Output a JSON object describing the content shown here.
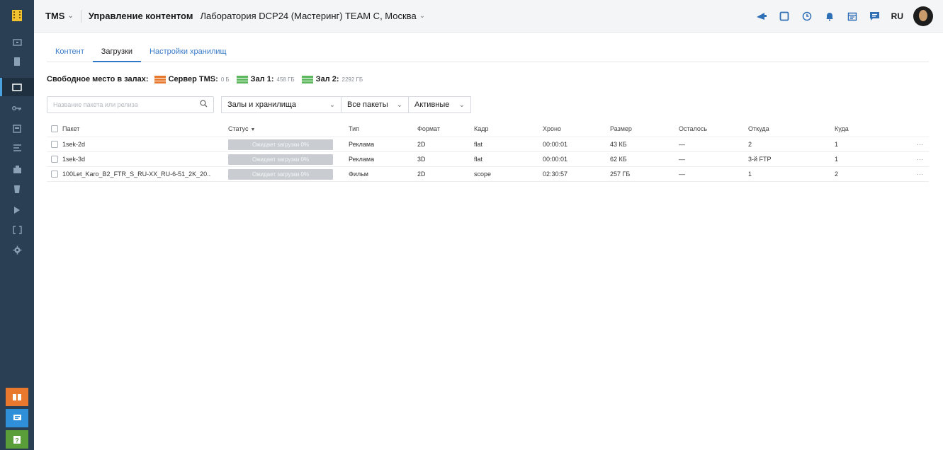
{
  "header": {
    "app_name": "TMS",
    "section": "Управление контентом",
    "location": "Лаборатория DCP24 (Мастеринг) TEAM C, Москва",
    "language": "RU"
  },
  "tabs": [
    {
      "label": "Контент"
    },
    {
      "label": "Загрузки"
    },
    {
      "label": "Настройки хранилищ"
    }
  ],
  "free_space": {
    "label": "Свободное место в залах:",
    "items": [
      {
        "name": "Сервер TMS:",
        "value": "0 Б",
        "color": "#e8782d"
      },
      {
        "name": "Зал 1:",
        "value": "458 ГБ",
        "color": "#5cb85c"
      },
      {
        "name": "Зал 2:",
        "value": "2292 ГБ",
        "color": "#5cb85c"
      }
    ]
  },
  "filters": {
    "search_placeholder": "Название пакета или релиза",
    "halls": "Залы и хранилища",
    "packages": "Все пакеты",
    "state": "Активные"
  },
  "table": {
    "columns": {
      "package": "Пакет",
      "status": "Статус",
      "type": "Тип",
      "format": "Формат",
      "frame": "Кадр",
      "chrono": "Хроно",
      "size": "Размер",
      "left": "Осталось",
      "from": "Откуда",
      "to": "Куда"
    },
    "rows": [
      {
        "package": "1sek-2d",
        "status": "Ожидает загрузки 0%",
        "type": "Реклама",
        "format": "2D",
        "frame": "flat",
        "chrono": "00:00:01",
        "size": "43 КБ",
        "left": "—",
        "from": "2",
        "to": "1",
        "more": "···"
      },
      {
        "package": "1sek-3d",
        "status": "Ожидает загрузки 0%",
        "type": "Реклама",
        "format": "3D",
        "frame": "flat",
        "chrono": "00:00:01",
        "size": "62 КБ",
        "left": "—",
        "from": "3-й FTP",
        "to": "1",
        "more": "···"
      },
      {
        "package": "100Let_Karo_B2_FTR_S_RU-XX_RU-6-51_2K_20...",
        "status": "Ожидает загрузки 0%",
        "type": "Фильм",
        "format": "2D",
        "frame": "scope",
        "chrono": "02:30:57",
        "size": "257 ГБ",
        "left": "—",
        "from": "1",
        "to": "2",
        "more": "···"
      }
    ]
  },
  "icons": {
    "sidebar": [
      "logo-icon",
      "monitor-icon",
      "film-icon",
      "folder-icon",
      "key-icon",
      "calendar-icon",
      "playlist-icon",
      "projector-icon",
      "screen-icon",
      "arrow-right-icon",
      "brackets-icon",
      "gear-icon"
    ],
    "sidebar_bottom": [
      "book-icon",
      "chat-icon",
      "help-icon"
    ],
    "topbar": [
      "megaphone-icon",
      "tablet-icon",
      "history-icon",
      "bell-icon",
      "calendar-icon",
      "message-icon"
    ]
  },
  "colors": {
    "sidebar_bg": "#2a3f54",
    "accent": "#2f77c7",
    "help_orange": "#e8782d",
    "chat_blue": "#2f8fd8",
    "help_green": "#5a9e3a"
  }
}
